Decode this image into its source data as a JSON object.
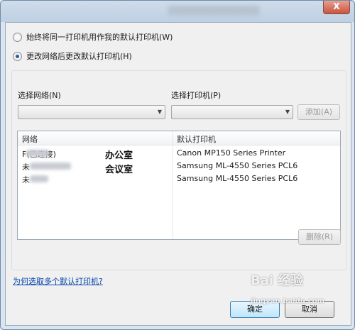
{
  "window": {
    "close_glyph": "X"
  },
  "options": {
    "same_printer_label": "始终将同一打印机用作我的默认打印机(W)",
    "change_printer_label": "更改网络后更改默认打印机(H)",
    "selected": "change_printer"
  },
  "group": {
    "network_label": "选择网络(N)",
    "printer_label": "选择打印机(P)",
    "network_value": "",
    "printer_value": "",
    "add_button": "添加(A)",
    "columns": [
      "网络",
      "默认打印机"
    ],
    "rows": [
      {
        "network": "F",
        "network_suffix": "(已连接)",
        "printer": "Canon MP150 Series Printer"
      },
      {
        "network": "未",
        "network_suffix": "",
        "printer": "Samsung ML-4550 Series PCL6"
      },
      {
        "network": "未",
        "network_suffix": "",
        "printer": "Samsung ML-4550 Series PCL6"
      }
    ],
    "remove_button": "删除(R)"
  },
  "annotations": [
    "办公室",
    "会议室"
  ],
  "footer": {
    "help_link": "为何选取多个默认打印机?",
    "ok_button": "确定",
    "cancel_button": "取消"
  },
  "watermark": {
    "brand": "Bai 经验",
    "url": "jingyan.baidu.com"
  },
  "colors": {
    "link": "#0645ad",
    "accent": "#2a5d9a"
  }
}
